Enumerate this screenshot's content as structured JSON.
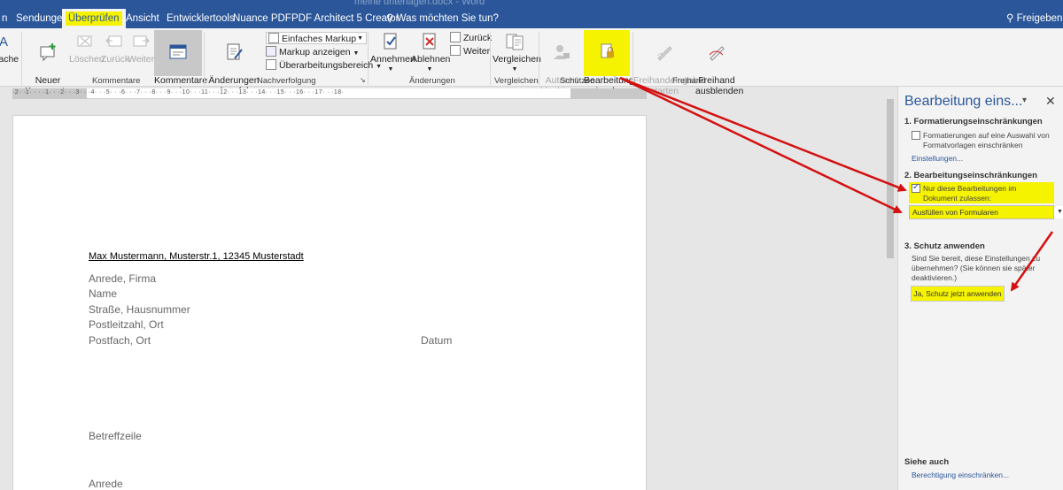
{
  "title_bar": {
    "doc_title": "meine unterlagen.docx  -  Word"
  },
  "tabs": [
    {
      "label": "n"
    },
    {
      "label": "Sendungen"
    },
    {
      "label": "Überprüfen",
      "active": true
    },
    {
      "label": "Ansicht"
    },
    {
      "label": "Entwicklertools"
    },
    {
      "label": "Nuance PDF"
    },
    {
      "label": "PDF Architect 5 Creator"
    }
  ],
  "tell_me": "Was möchten Sie tun?",
  "share": "Freigeben",
  "ribbon": {
    "sprache": "rache",
    "kommentare": {
      "neuer": "Neuer\nKommentar",
      "loeschen": "Löschen",
      "zurueck": "Zurück",
      "weiter": "Weiter",
      "anzeigen": "Kommentare\nanzeigen",
      "group": "Kommentare"
    },
    "nachverfolgung": {
      "aenderungen": "Änderungen\nnachverfolgen",
      "markup_select": "Einfaches Markup",
      "markup_anzeigen": "Markup anzeigen",
      "ueberarbeitungsbereich": "Überarbeitungsbereich",
      "group": "Nachverfolgung"
    },
    "aenderungen": {
      "annehmen": "Annehmen",
      "ablehnen": "Ablehnen",
      "zurueck": "Zurück",
      "weiter": "Weiter",
      "group": "Änderungen"
    },
    "vergleichen": {
      "label": "Vergleichen",
      "group": "Vergleichen"
    },
    "schuetzen": {
      "autoren": "Autoren\nblockieren",
      "bearbeitung": "Bearbeitung\neinschr.",
      "group": "Schützen"
    },
    "freihand": {
      "eingabe": "Freihandeingabe\nstarten",
      "ausblenden": "Freihand\nausblenden",
      "group": "Freihand"
    }
  },
  "ruler": {
    "text": "·2·  ·1·  ·  ·  ·1·  ·  ·2·  ·  ·3·  ·  ·4·  ·  ·5·  ·  ·6·  ·  ·7·  ·  ·8·  ·  ·9·  ·  ·10·  ·  ·11·  ·  ·12·  ·  ·13·  ·  ·14·  ·  ·15·  ·  ·16·  ·  ·17·  ·  ·18·"
  },
  "document": {
    "sender": "Max Mustermann, Musterstr.1, 12345 Musterstadt",
    "recipient": [
      "Anrede, Firma",
      "Name",
      "Straße, Hausnummer",
      "Postleitzahl, Ort",
      "Postfach, Ort"
    ],
    "date": "Datum",
    "subject": "Betreffzeile",
    "salutation": "Anrede"
  },
  "pane": {
    "title": "Bearbeitung eins...",
    "menu": "▾",
    "close": "✕",
    "section1": {
      "heading": "1. Formatierungseinschränkungen",
      "checkbox": "Formatierungen auf eine Auswahl von Formatvorlagen einschränken",
      "link": "Einstellungen..."
    },
    "section2": {
      "heading": "2. Bearbeitungseinschränkungen",
      "checkbox": "Nur diese Bearbeitungen im Dokument zulassen:",
      "select": "Ausfüllen von Formularen"
    },
    "section3": {
      "heading": "3. Schutz anwenden",
      "text": "Sind Sie bereit, diese Einstellungen zu übernehmen? (Sie können sie später deaktivieren.)",
      "button": "Ja, Schutz jetzt anwenden"
    },
    "see_also": {
      "heading": "Siehe auch",
      "link": "Berechtigung einschränken..."
    }
  },
  "colors": {
    "accent": "#2b579a",
    "highlight": "#f6f300",
    "arrow": "#d41010"
  }
}
